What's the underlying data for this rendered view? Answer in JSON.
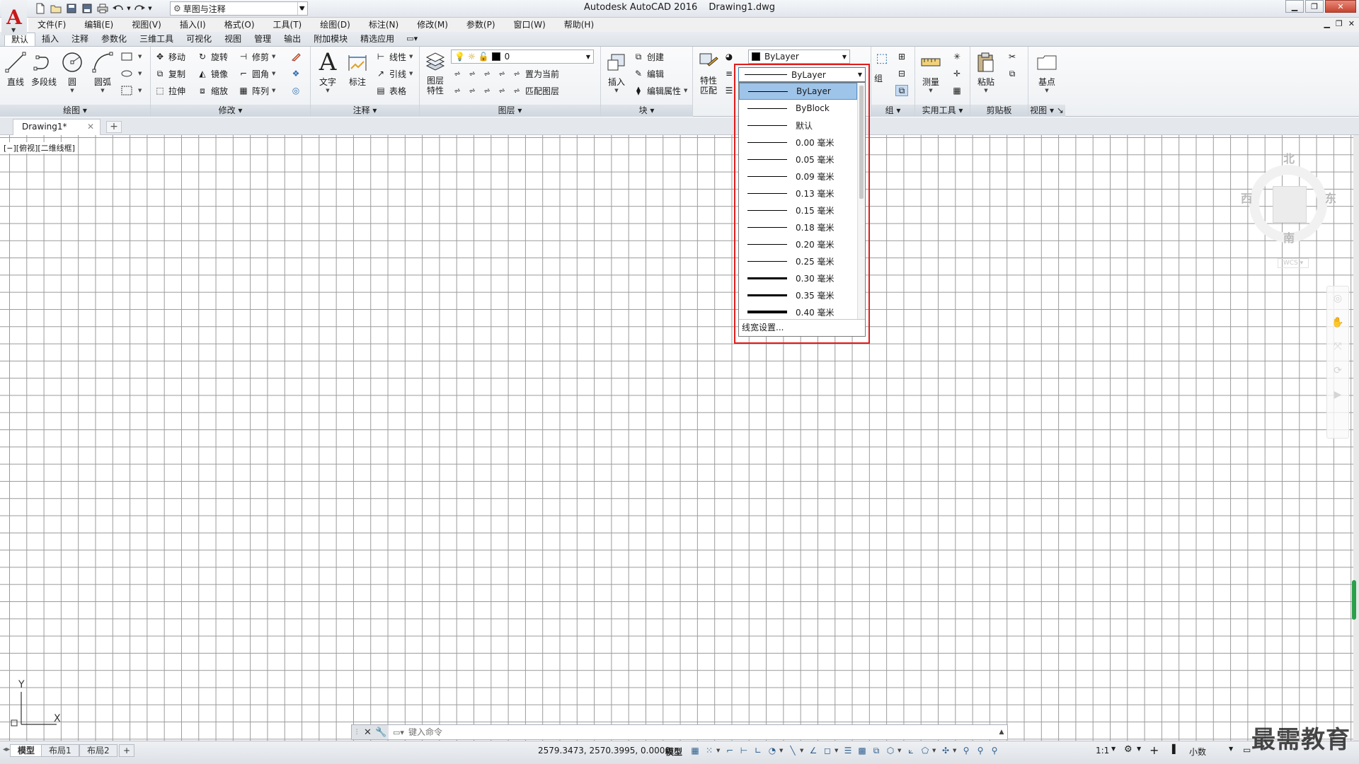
{
  "title": {
    "app": "Autodesk AutoCAD 2016",
    "document": "Drawing1.dwg"
  },
  "workspace": {
    "value": "草图与注释"
  },
  "menu": [
    "文件(F)",
    "编辑(E)",
    "视图(V)",
    "插入(I)",
    "格式(O)",
    "工具(T)",
    "绘图(D)",
    "标注(N)",
    "修改(M)",
    "参数(P)",
    "窗口(W)",
    "帮助(H)"
  ],
  "ribbon_tabs": [
    "默认",
    "插入",
    "注释",
    "参数化",
    "三维工具",
    "可视化",
    "视图",
    "管理",
    "输出",
    "附加模块",
    "精选应用"
  ],
  "ribbon": {
    "draw": {
      "title": "绘图",
      "line": "直线",
      "polyline": "多段线",
      "circle": "圆",
      "arc": "圆弧"
    },
    "modify": {
      "title": "修改",
      "move": "移动",
      "rotate": "旋转",
      "trim": "修剪",
      "copy": "复制",
      "mirror": "镜像",
      "fillet": "圆角",
      "stretch": "拉伸",
      "scale": "缩放",
      "array": "阵列"
    },
    "annotation": {
      "title": "注释",
      "text": "文字",
      "dimension": "标注",
      "linear": "线性",
      "leader": "引线",
      "table": "表格"
    },
    "layers": {
      "title": "图层",
      "properties_l1": "图层",
      "properties_l2": "特性",
      "current_layer": "0",
      "make_current": "置为当前",
      "match_layer": "匹配图层"
    },
    "block": {
      "title": "块",
      "insert": "插入",
      "create": "创建",
      "edit": "编辑",
      "edit_attributes": "编辑属性"
    },
    "properties": {
      "match_l1": "特性",
      "match_l2": "匹配",
      "color_value": "ByLayer"
    },
    "groups": {
      "title": "组",
      "group": "组"
    },
    "utilities": {
      "title": "实用工具",
      "measure": "测量"
    },
    "clipboard": {
      "title": "剪贴板",
      "paste": "粘贴"
    },
    "view": {
      "title": "视图",
      "base": "基点"
    }
  },
  "file_tab": {
    "label": "Drawing1*"
  },
  "viewport_label": "[−][俯视][二维线框]",
  "viewcube": {
    "north": "北",
    "south": "南",
    "east": "东",
    "west": "西",
    "wcs": "WCS"
  },
  "lineweight": {
    "current": "ByLayer",
    "items": [
      {
        "label": "ByLayer",
        "weight": 1,
        "selected": true
      },
      {
        "label": "ByBlock",
        "weight": 1
      },
      {
        "label": "默认",
        "weight": 1
      },
      {
        "label": "0.00 毫米",
        "weight": 1
      },
      {
        "label": "0.05 毫米",
        "weight": 1
      },
      {
        "label": "0.09 毫米",
        "weight": 1
      },
      {
        "label": "0.13 毫米",
        "weight": 1
      },
      {
        "label": "0.15 毫米",
        "weight": 1
      },
      {
        "label": "0.18 毫米",
        "weight": 1
      },
      {
        "label": "0.20 毫米",
        "weight": 1
      },
      {
        "label": "0.25 毫米",
        "weight": 1
      },
      {
        "label": "0.30 毫米",
        "weight": 3
      },
      {
        "label": "0.35 毫米",
        "weight": 3
      },
      {
        "label": "0.40 毫米",
        "weight": 4
      }
    ],
    "settings": "线宽设置..."
  },
  "ucs": {
    "x": "X",
    "y": "Y"
  },
  "command": {
    "placeholder": "键入命令"
  },
  "layouts": [
    "模型",
    "布局1",
    "布局2"
  ],
  "status": {
    "coordinates": "2579.3473, 2570.3995, 0.0000",
    "space": "模型",
    "scale": "1:1",
    "units": "小数"
  },
  "watermark": "最需教育",
  "colors": {
    "accent": "#e01b1b",
    "selection": "#9fc4e9",
    "brand": "#c81818"
  }
}
